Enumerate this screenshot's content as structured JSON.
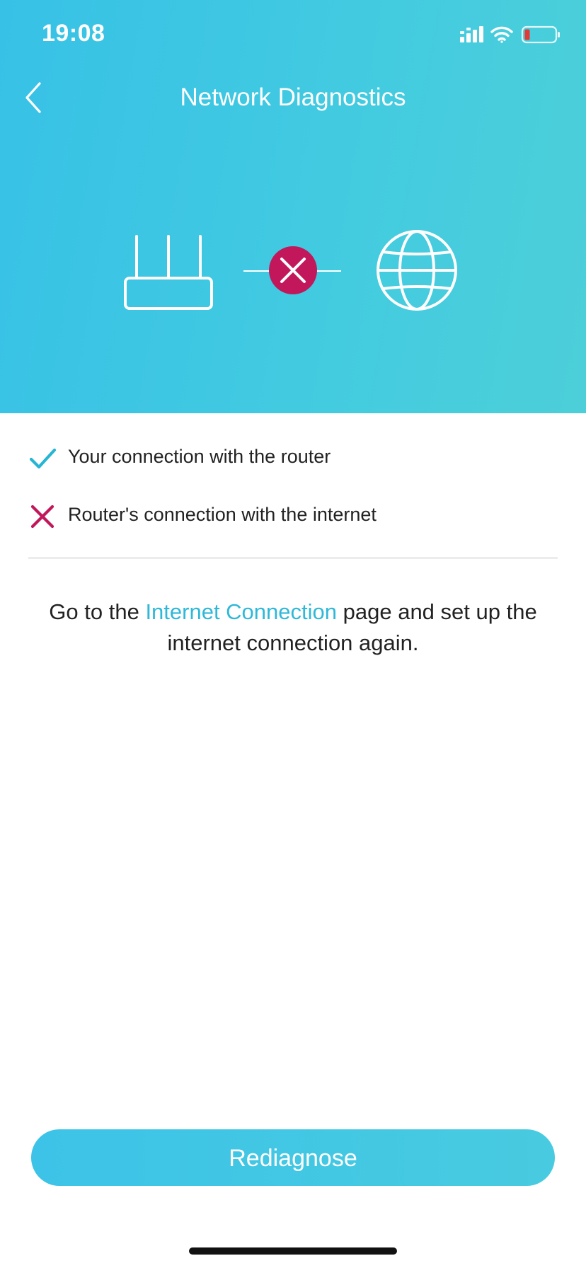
{
  "status_bar": {
    "time": "19:08",
    "icons": [
      "cellular-signal-icon",
      "wifi-icon",
      "battery-icon"
    ],
    "battery_color": "#e53935"
  },
  "nav": {
    "title": "Network Diagnostics",
    "back_icon": "chevron-left-icon"
  },
  "diagram": {
    "nodes": [
      "router-icon",
      "globe-icon"
    ],
    "link_status": "error",
    "error_color": "#c2185b"
  },
  "checks": [
    {
      "label": "Your connection with the router",
      "status": "pass",
      "icon": "checkmark-icon",
      "color": "#26b5d3"
    },
    {
      "label": "Router's connection with the internet",
      "status": "fail",
      "icon": "cross-icon",
      "color": "#c2185b"
    }
  ],
  "instruction": {
    "before": "Go to the ",
    "link": "Internet Connection",
    "after": " page and set up the internet connection again.",
    "link_color": "#2fb8d8"
  },
  "actions": {
    "rediagnose_label": "Rediagnose"
  },
  "colors": {
    "header_start": "#37c1e6",
    "header_end": "#4ccfd8",
    "accent": "#2fb8d8",
    "error": "#c2185b"
  }
}
